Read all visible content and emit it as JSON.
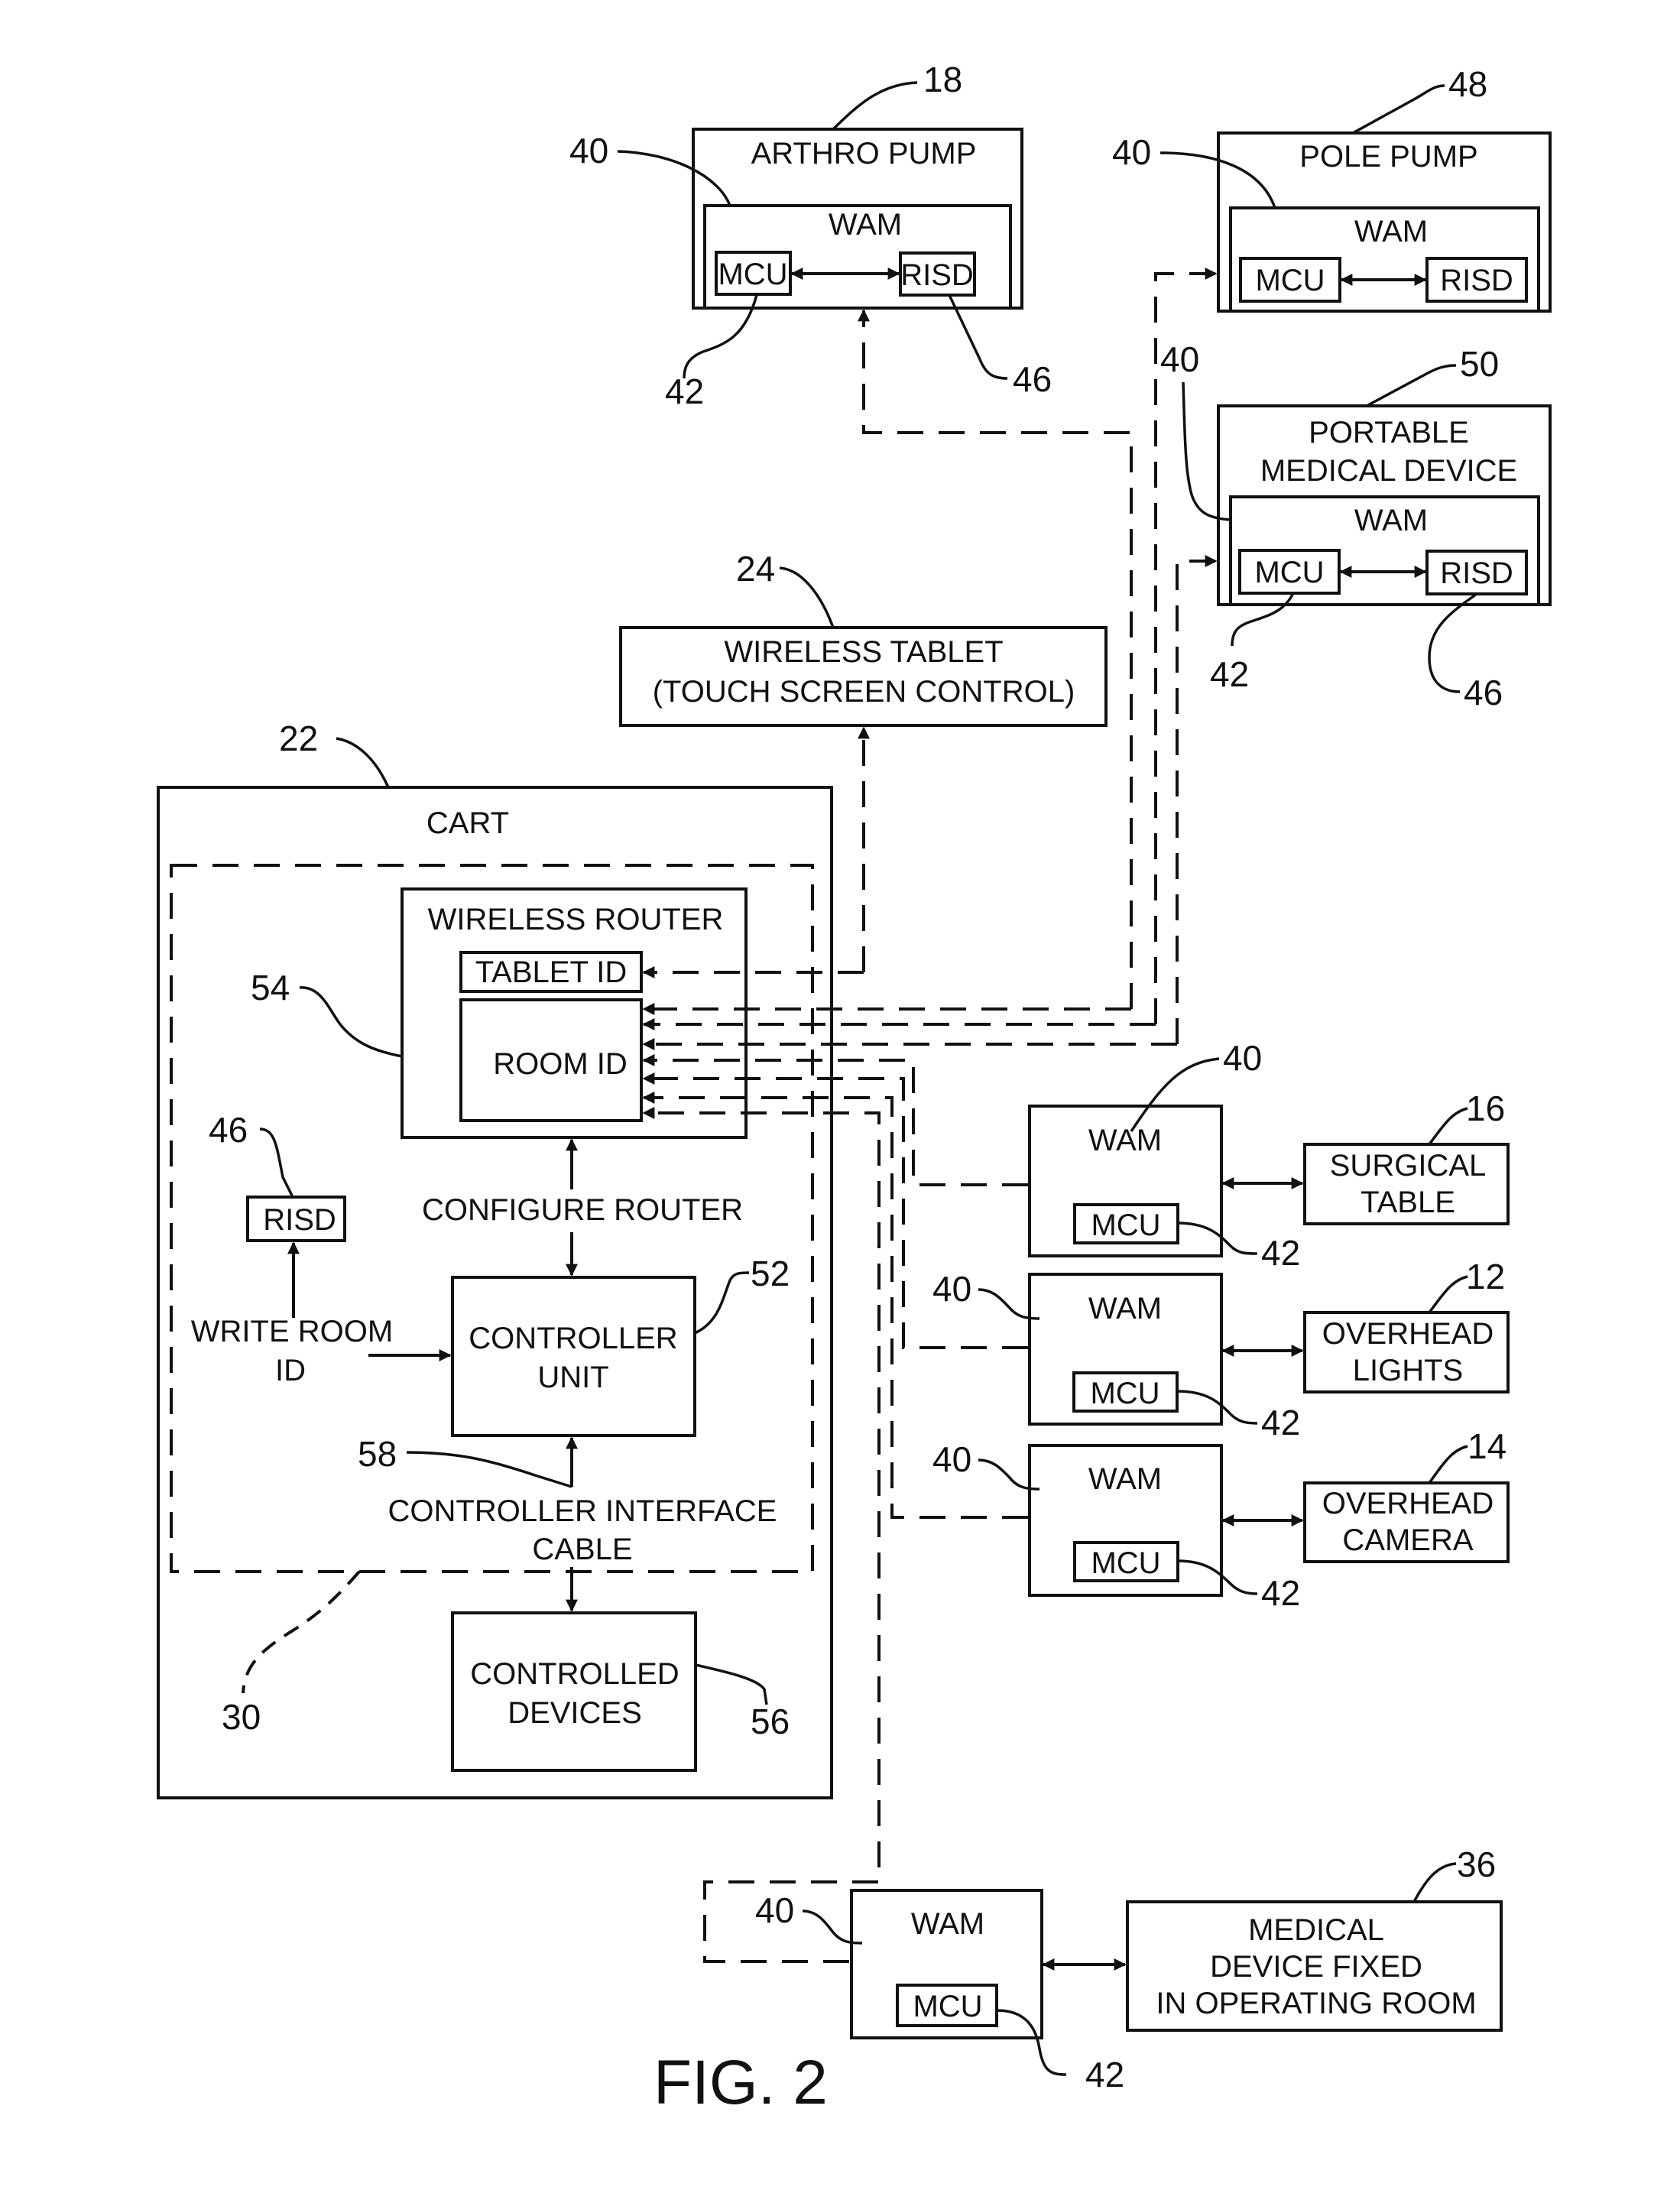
{
  "figure_label": "FIG. 2",
  "blocks": {
    "arthro_pump": {
      "title": "ARTHRO PUMP",
      "ref": "18",
      "wam": "WAM",
      "wam_ref": "40",
      "mcu": "MCU",
      "mcu_ref": "42",
      "risd": "RISD",
      "risd_ref": "46"
    },
    "pole_pump": {
      "title": "POLE PUMP",
      "ref": "48",
      "wam": "WAM",
      "wam_ref": "40",
      "mcu": "MCU",
      "risd": "RISD"
    },
    "portable_device": {
      "title_line1": "PORTABLE",
      "title_line2": "MEDICAL DEVICE",
      "ref": "50",
      "wam": "WAM",
      "wam_ref": "40",
      "mcu": "MCU",
      "mcu_ref": "42",
      "risd": "RISD",
      "risd_ref": "46"
    },
    "wireless_tablet": {
      "line1": "WIRELESS TABLET",
      "line2": "(TOUCH SCREEN CONTROL)",
      "ref": "24"
    },
    "cart": {
      "title": "CART",
      "ref": "22",
      "dashed_ref": "30"
    },
    "wireless_router": {
      "title": "WIRELESS ROUTER",
      "ref": "54",
      "tablet_id": "TABLET ID",
      "room_id": "ROOM ID"
    },
    "cart_risd": {
      "label": "RISD",
      "ref": "46"
    },
    "configure_router": "CONFIGURE ROUTER",
    "write_room_id_line1": "WRITE ROOM",
    "write_room_id_line2": "ID",
    "controller_unit": {
      "line1": "CONTROLLER",
      "line2": "UNIT",
      "ref": "52"
    },
    "controller_cable": {
      "line1": "CONTROLLER INTERFACE",
      "line2": "CABLE",
      "ref": "58"
    },
    "controlled_devices": {
      "line1": "CONTROLLED",
      "line2": "DEVICES",
      "ref": "56"
    },
    "wam_surgical": {
      "wam": "WAM",
      "wam_ref": "40",
      "mcu": "MCU",
      "mcu_ref": "42"
    },
    "surgical_table": {
      "line1": "SURGICAL",
      "line2": "TABLE",
      "ref": "16"
    },
    "wam_lights": {
      "wam": "WAM",
      "wam_ref": "40",
      "mcu": "MCU",
      "mcu_ref": "42"
    },
    "overhead_lights": {
      "line1": "OVERHEAD",
      "line2": "LIGHTS",
      "ref": "12"
    },
    "wam_camera": {
      "wam": "WAM",
      "wam_ref": "40",
      "mcu": "MCU",
      "mcu_ref": "42"
    },
    "overhead_camera": {
      "line1": "OVERHEAD",
      "line2": "CAMERA",
      "ref": "14"
    },
    "wam_fixed": {
      "wam": "WAM",
      "wam_ref": "40",
      "mcu": "MCU",
      "mcu_ref": "42"
    },
    "fixed_device": {
      "line1": "MEDICAL",
      "line2": "DEVICE FIXED",
      "line3": "IN OPERATING ROOM",
      "ref": "36"
    }
  }
}
